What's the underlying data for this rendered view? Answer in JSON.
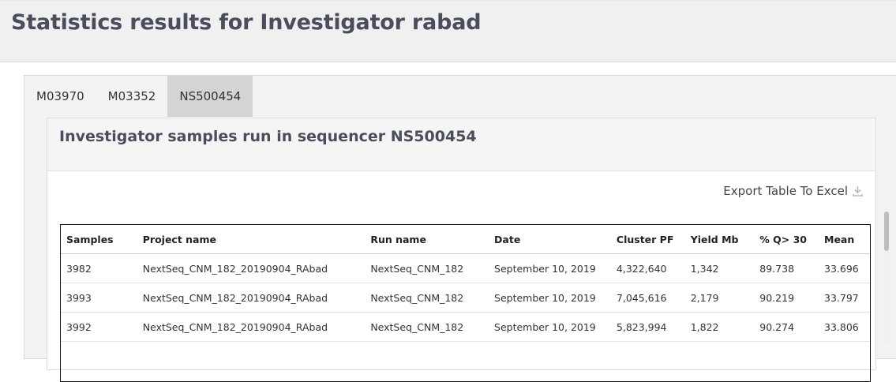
{
  "page": {
    "title": "Statistics results for Investigator rabad"
  },
  "tabs": [
    {
      "label": "M03970",
      "active": false
    },
    {
      "label": "M03352",
      "active": false
    },
    {
      "label": "NS500454",
      "active": true
    }
  ],
  "card": {
    "title": "Investigator samples run in sequencer NS500454",
    "export_label": "Export Table To Excel"
  },
  "table": {
    "columns": [
      "Samples",
      "Project name",
      "Run name",
      "Date",
      "Cluster PF",
      "Yield Mb",
      "% Q> 30",
      "Mean"
    ],
    "rows": [
      [
        "3982",
        "NextSeq_CNM_182_20190904_RAbad",
        "NextSeq_CNM_182",
        "September 10, 2019",
        "4,322,640",
        "1,342",
        "89.738",
        "33.696"
      ],
      [
        "3993",
        "NextSeq_CNM_182_20190904_RAbad",
        "NextSeq_CNM_182",
        "September 10, 2019",
        "7,045,616",
        "2,179",
        "90.219",
        "33.797"
      ],
      [
        "3992",
        "NextSeq_CNM_182_20190904_RAbad",
        "NextSeq_CNM_182",
        "September 10, 2019",
        "5,823,994",
        "1,822",
        "90.274",
        "33.806"
      ]
    ]
  },
  "icons": {
    "export": "download-icon"
  },
  "colors": {
    "heading": "#4a4d5c",
    "active_tab": "#d4d4d4"
  }
}
